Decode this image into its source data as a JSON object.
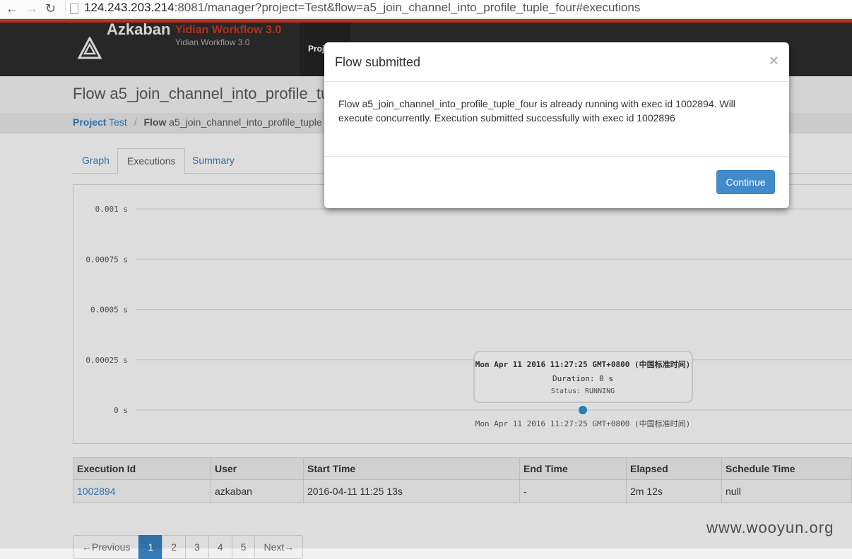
{
  "browser": {
    "url_host": "124.243.203.214",
    "url_rest": ":8081/manager?project=Test&flow=a5_join_channel_into_profile_tuple_four#executions",
    "back_icon": "arrow-left-icon",
    "forward_icon": "arrow-right-icon",
    "reload_icon": "reload-icon"
  },
  "header": {
    "brand": "Azkaban",
    "subtitle": "Yidian Workflow 3.0",
    "subtitle2": "Yidian Workflow 3.0",
    "nav_projects": "Proj",
    "accent": "#c23321"
  },
  "page": {
    "title": "Flow a5_join_channel_into_profile_tu",
    "breadcrumb": {
      "project_label": "Project",
      "project_value": "Test",
      "flow_label": "Flow",
      "flow_value": "a5_join_channel_into_profile_tuple"
    }
  },
  "tabs": [
    {
      "label": "Graph"
    },
    {
      "label": "Executions",
      "active": true
    },
    {
      "label": "Summary"
    }
  ],
  "chart_data": {
    "type": "scatter",
    "y_ticks": [
      "0.001 s",
      "0.00075 s",
      "0.0005 s",
      "0.00025 s",
      "0 s"
    ],
    "y_values": [
      0.001,
      0.00075,
      0.0005,
      0.00025,
      0
    ],
    "ylim": [
      0,
      0.001
    ],
    "x_label_point": "Mon Apr 11 2016 11:27:25 GMT+0800 (中国标准时间)",
    "points": [
      {
        "x": "Mon Apr 11 2016 11:27:25 GMT+0800",
        "y": 0,
        "status": "RUNNING"
      }
    ],
    "tooltip": {
      "time": "Mon Apr 11 2016 11:27:25 GMT+0800 (中国标准时间)",
      "duration": "Duration: 0 s",
      "status": "Status: RUNNING"
    },
    "grid": true,
    "point_color": "#2a8bc2"
  },
  "table": {
    "headers": [
      "Execution Id",
      "User",
      "Start Time",
      "End Time",
      "Elapsed",
      "Schedule Time"
    ],
    "rows": [
      [
        "1002894",
        "azkaban",
        "2016-04-11 11:25 13s",
        "-",
        "2m 12s",
        "null"
      ]
    ]
  },
  "pagination": {
    "prev": "←Previous",
    "pages": [
      "1",
      "2",
      "3",
      "4",
      "5"
    ],
    "next": "Next→",
    "active": "1"
  },
  "modal": {
    "title": "Flow submitted",
    "close": "×",
    "body": "Flow a5_join_channel_into_profile_tuple_four is already running with exec id 1002894. Will execute concurrently. Execution submitted successfully with exec id 1002896",
    "button": "Continue"
  },
  "watermark": "www.wooyun.org"
}
